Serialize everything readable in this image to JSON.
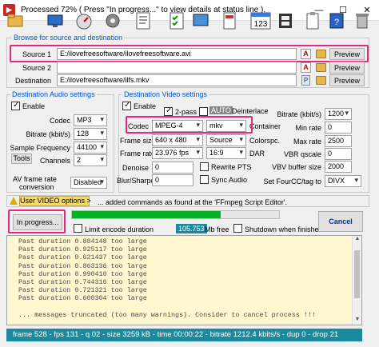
{
  "window": {
    "title": "Processed  72%  ( Press \"In progress...\" to view details at status line ).",
    "controls": {
      "minimize": "—",
      "maximize": "☐",
      "close": "✕"
    }
  },
  "toolbar": {
    "icons": [
      "open-folder",
      "monitor",
      "gauge",
      "settings-gear",
      "script",
      "checklist",
      "calendar-123",
      "film-strip",
      "clipboard",
      "help-book",
      "recycle-bin"
    ],
    "badges": {
      "calendar": "123"
    }
  },
  "source_group": {
    "title": "Browse for source and destination",
    "source1_label": "Source 1",
    "source1_value": "E:/ilovefreesoftware/ilovefreesoftware.avi",
    "source2_label": "Source 2",
    "source2_value": "",
    "destination_label": "Destination",
    "destination_value": "E:/ilovefreesoftware/ilfs.mkv",
    "preview_label": "Preview",
    "a_glyph": "A",
    "p_glyph": "P"
  },
  "audio_group": {
    "title": "Destination Audio settings",
    "enable_label": "Enable",
    "enable_checked": true,
    "codec_label": "Codec",
    "codec_value": "MP3",
    "bitrate_label": "Bitrate (kbit/s)",
    "bitrate_value": "128",
    "sample_label": "Sample Frequency",
    "sample_value": "44100",
    "tools_label": "Tools",
    "channels_label": "Channels",
    "channels_value": "2",
    "av_frame_label_1": "AV frame rate",
    "av_frame_label_2": "conversion",
    "av_frame_value": "Disabled"
  },
  "video_group": {
    "title": "Destination Video settings",
    "enable_label": "Enable",
    "enable_checked": true,
    "two_pass_label": "2-pass",
    "auto_label": "AUTO",
    "deinterlace_label": "Deinterlace",
    "codec_label": "Codec",
    "codec_value": "MPEG-4",
    "container_value": "mkv",
    "container_label": "Container",
    "frame_size_label": "Frame size",
    "frame_size_value": "640 x 480",
    "frame_size_source": "Source",
    "colorspc_label": "Colorspc.",
    "frame_rate_label": "Frame rate",
    "frame_rate_value": "23.976 fps",
    "aspect_value": "16:9",
    "dar_label": "DAR",
    "denoise_label": "Denoise",
    "denoise_value": "0",
    "rewrite_pts_label": "Rewrite PTS",
    "blur_label": "Blur/Sharpen",
    "blur_value": "0",
    "sync_audio_label": "Sync Audio",
    "bitrate_label": "Bitrate (kbit/s)",
    "bitrate_value": "1200",
    "min_rate_label": "Min rate",
    "min_rate_value": "0",
    "max_rate_label": "Max rate",
    "max_rate_value": "2500",
    "vbr_label": "VBR qscale",
    "vbr_value": "0",
    "vbv_label": "VBV buffer size",
    "vbv_value": "2000",
    "fourcc_label": "Set FourCC/tag to",
    "fourcc_value": "DIVX"
  },
  "options_bar": {
    "user_video_label": "User VIDEO options >",
    "text": "... added commands as found at the 'FFmpeg Script Editor'."
  },
  "progress_area": {
    "in_progress_label": "In progress...",
    "progress_percent": 72,
    "limit_label": "Limit encode duration",
    "limit_value": "105.753",
    "mb_free_label": "Mb free",
    "shutdown_label": "Shutdown when finished",
    "cancel_label": "Cancel"
  },
  "log": {
    "lines": [
      "Past duration 0.884148 too large",
      "Past duration 0.925117 too large",
      "Past duration 0.621437 too large",
      "Past duration 0.863136 too large",
      "Past duration 0.990410 too large",
      "Past duration 0.744316 too large",
      "Past duration 0.721321 too large",
      "Past duration 0.600304 too large",
      "",
      "... messages truncated (too many warnings). Consider to cancel process !!!"
    ]
  },
  "status_line": "frame  528 - fps 131 - q 02 - size 3259 kB - time 00:00:22 - bitrate 1212.4 kbits/s - dup 0 - drop 21",
  "colors": {
    "accent_blue": "#0055cc",
    "highlight_pink": "#e8287a",
    "progress_green": "#06b025",
    "status_teal": "#1c8a9e",
    "log_background": "#fff7cf"
  }
}
